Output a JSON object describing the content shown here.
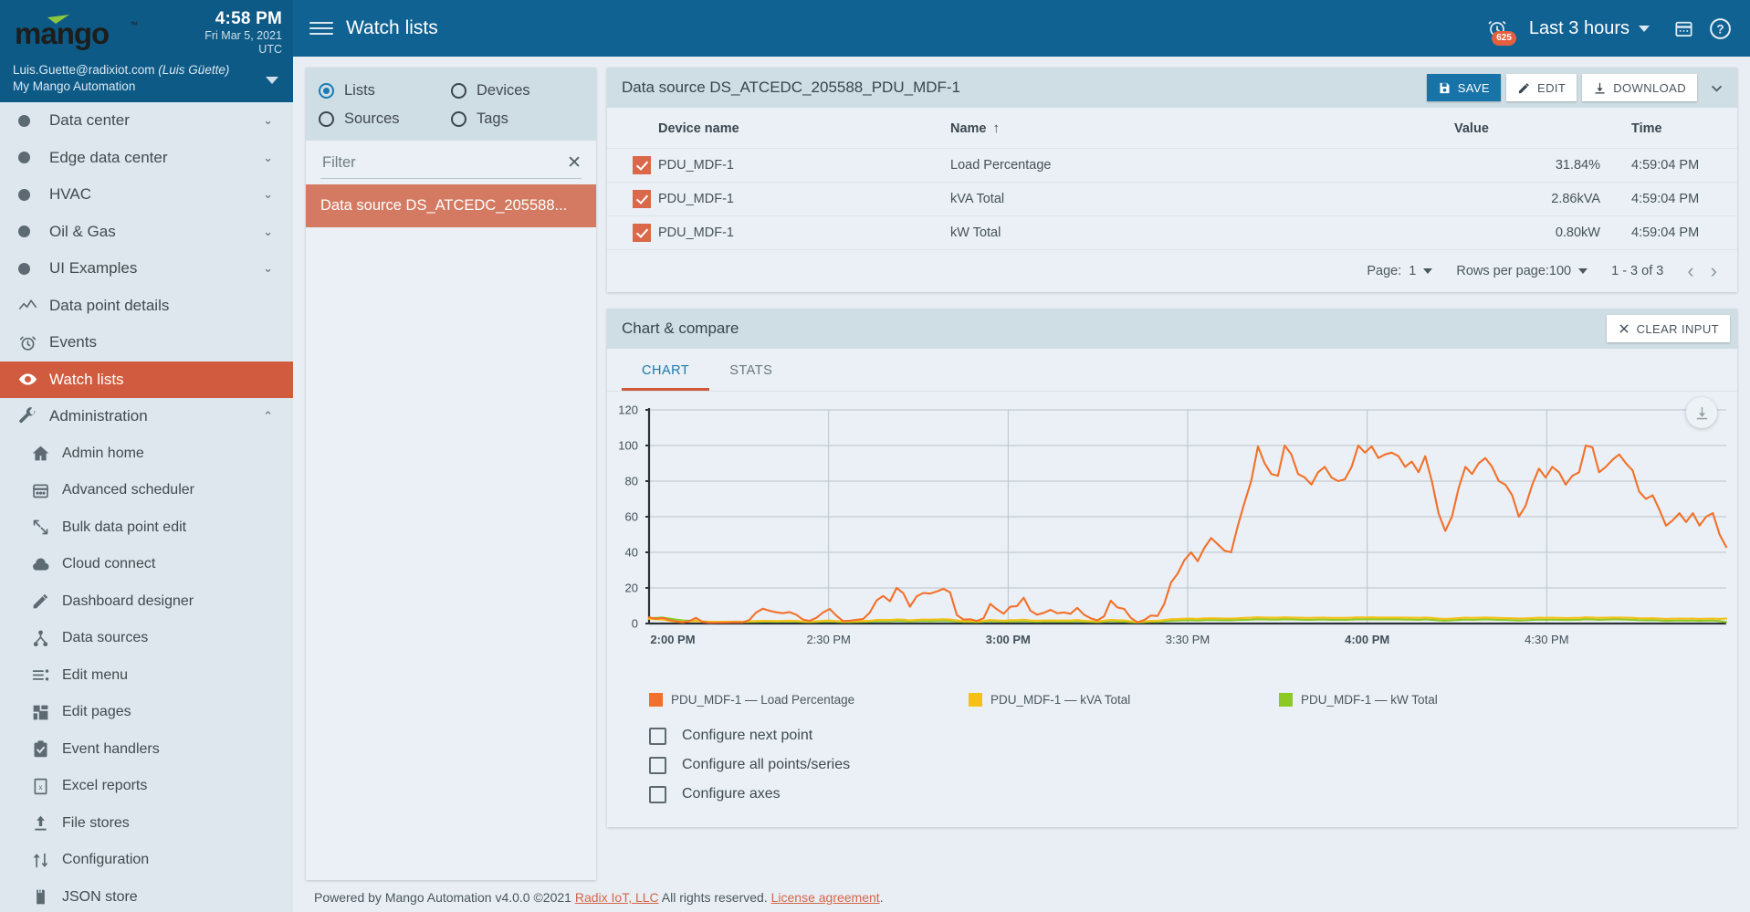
{
  "topbar": {
    "time": "4:58 PM",
    "date": "Fri Mar 5, 2021",
    "timezone": "UTC",
    "page_title": "Watch lists",
    "alarm_count": "625",
    "time_range": "Last 3 hours"
  },
  "user": {
    "email": "Luis.Guette@radixiot.com",
    "display_name": "(Luis Güette)",
    "instance": "My Mango Automation"
  },
  "sidebar": {
    "items": [
      {
        "label": "Data center",
        "icon": "dot-icon",
        "expandable": true,
        "sub": false,
        "active": false
      },
      {
        "label": "Edge data center",
        "icon": "dot-icon",
        "expandable": true,
        "sub": false,
        "active": false
      },
      {
        "label": "HVAC",
        "icon": "dot-icon",
        "expandable": true,
        "sub": false,
        "active": false
      },
      {
        "label": "Oil & Gas",
        "icon": "dot-icon",
        "expandable": true,
        "sub": false,
        "active": false
      },
      {
        "label": "UI Examples",
        "icon": "dot-icon",
        "expandable": true,
        "sub": false,
        "active": false
      },
      {
        "label": "Data point details",
        "icon": "line-chart-icon",
        "expandable": false,
        "sub": false,
        "active": false
      },
      {
        "label": "Events",
        "icon": "alarm-clock-icon",
        "expandable": false,
        "sub": false,
        "active": false
      },
      {
        "label": "Watch lists",
        "icon": "eye-icon",
        "expandable": false,
        "sub": false,
        "active": true
      },
      {
        "label": "Administration",
        "icon": "wrench-icon",
        "expandable": true,
        "sub": false,
        "active": false,
        "expanded": true
      },
      {
        "label": "Admin home",
        "icon": "home-icon",
        "expandable": false,
        "sub": true,
        "active": false
      },
      {
        "label": "Advanced scheduler",
        "icon": "calendar-icon",
        "expandable": false,
        "sub": true,
        "active": false
      },
      {
        "label": "Bulk data point edit",
        "icon": "bulk-edit-icon",
        "expandable": false,
        "sub": true,
        "active": false
      },
      {
        "label": "Cloud connect",
        "icon": "cloud-icon",
        "expandable": false,
        "sub": true,
        "active": false
      },
      {
        "label": "Dashboard designer",
        "icon": "pencil-icon",
        "expandable": false,
        "sub": true,
        "active": false
      },
      {
        "label": "Data sources",
        "icon": "sitemap-icon",
        "expandable": false,
        "sub": true,
        "active": false
      },
      {
        "label": "Edit menu",
        "icon": "menu-list-icon",
        "expandable": false,
        "sub": true,
        "active": false
      },
      {
        "label": "Edit pages",
        "icon": "grid-layout-icon",
        "expandable": false,
        "sub": true,
        "active": false
      },
      {
        "label": "Event handlers",
        "icon": "clipboard-check-icon",
        "expandable": false,
        "sub": true,
        "active": false
      },
      {
        "label": "Excel reports",
        "icon": "excel-file-icon",
        "expandable": false,
        "sub": true,
        "active": false
      },
      {
        "label": "File stores",
        "icon": "upload-icon",
        "expandable": false,
        "sub": true,
        "active": false
      },
      {
        "label": "Configuration",
        "icon": "import-export-icon",
        "expandable": false,
        "sub": true,
        "active": false
      },
      {
        "label": "JSON store",
        "icon": "database-icon",
        "expandable": false,
        "sub": true,
        "active": false
      }
    ]
  },
  "watchlist_panel": {
    "radios": [
      {
        "label": "Lists",
        "selected": true
      },
      {
        "label": "Devices",
        "selected": false
      },
      {
        "label": "Sources",
        "selected": false
      },
      {
        "label": "Tags",
        "selected": false
      }
    ],
    "filter_placeholder": "Filter",
    "filter_value": "",
    "selected_list": "Data source DS_ATCEDC_205588..."
  },
  "datasource_card": {
    "title": "Data source DS_ATCEDC_205588_PDU_MDF-1",
    "buttons": {
      "save": "SAVE",
      "edit": "EDIT",
      "download": "DOWNLOAD"
    },
    "columns": [
      "Device name",
      "Name",
      "Value",
      "Time"
    ],
    "sorted_column": "Name",
    "sort_direction": "asc",
    "rows": [
      {
        "checked": true,
        "device": "PDU_MDF-1",
        "name": "Load Percentage",
        "value": "31.84%",
        "time": "4:59:04 PM"
      },
      {
        "checked": true,
        "device": "PDU_MDF-1",
        "name": "kVA Total",
        "value": "2.86kVA",
        "time": "4:59:04 PM"
      },
      {
        "checked": true,
        "device": "PDU_MDF-1",
        "name": "kW Total",
        "value": "0.80kW",
        "time": "4:59:04 PM"
      }
    ],
    "pager": {
      "page_label": "Page:",
      "page_value": "1",
      "rows_per_page_label": "Rows per page:100",
      "range": "1 - 3 of 3"
    }
  },
  "chart_card": {
    "title": "Chart & compare",
    "clear_input_label": "CLEAR INPUT",
    "tabs": [
      {
        "label": "CHART",
        "active": true
      },
      {
        "label": "STATS",
        "active": false
      }
    ],
    "checkboxes": [
      {
        "label": "Configure next point",
        "checked": false
      },
      {
        "label": "Configure all points/series",
        "checked": false
      },
      {
        "label": "Configure axes",
        "checked": false
      }
    ]
  },
  "footer": {
    "text_before": "Powered by Mango Automation v4.0.0 ©2021 ",
    "link1": "Radix IoT, LLC",
    "text_mid": " All rights reserved. ",
    "link2": "License agreement",
    "text_after": "."
  },
  "colors": {
    "brand_blue": "#106293",
    "accent_orange": "#d15b3f",
    "series_load_percentage": "#f4702a",
    "series_kva_total": "#f5c119",
    "series_kw_total": "#8cc925",
    "panel_header": "#cfdee4",
    "panel_body": "#eaf0f5"
  },
  "chart_data": {
    "type": "line",
    "title": "",
    "xlabel": "",
    "ylabel": "",
    "ylim": [
      0,
      120
    ],
    "yticks": [
      0,
      20,
      40,
      60,
      80,
      100,
      120
    ],
    "grid": true,
    "legend_position": "bottom",
    "xtick_labels": [
      "2:00 PM",
      "2:30 PM",
      "3:00 PM",
      "3:30 PM",
      "4:00 PM",
      "4:30 PM"
    ],
    "xtick_bold": [
      true,
      false,
      true,
      false,
      true,
      false
    ],
    "x_start": "2:00 PM",
    "x_end": "4:58 PM",
    "series": [
      {
        "name": "PDU_MDF-1 — Load Percentage",
        "color": "#f4702a",
        "values": [
          3.5,
          2.6,
          3.2,
          2.0,
          1.2,
          0.6,
          1.4,
          3.2,
          1.0,
          0.4,
          0.5,
          0.5,
          0.6,
          0.7,
          0.6,
          2.0,
          6.2,
          8.3,
          7.2,
          6.3,
          5.8,
          6.4,
          5.0,
          2.2,
          1.5,
          3.2,
          6.2,
          8.2,
          4.4,
          1.4,
          1.6,
          2.1,
          2.5,
          6.2,
          13.0,
          15.5,
          12.5,
          20.0,
          17.0,
          9.5,
          15.3,
          17.2,
          16.8,
          18.0,
          19.5,
          17.5,
          4.8,
          2.2,
          2.4,
          1.5,
          3.0,
          11.0,
          8.0,
          5.5,
          9.5,
          9.8,
          14.5,
          7.2,
          5.0,
          6.0,
          7.7,
          5.8,
          6.2,
          5.5,
          8.8,
          5.0,
          3.0,
          1.8,
          4.0,
          12.8,
          9.0,
          8.2,
          3.2,
          0.6,
          2.0,
          4.5,
          4.2,
          11.0,
          23.0,
          28.0,
          35.5,
          40.0,
          35.0,
          42.5,
          48.0,
          44.5,
          41.0,
          40.0,
          55.0,
          68.0,
          80.0,
          99.5,
          90.0,
          84.0,
          83.0,
          100.0,
          95.0,
          84.0,
          82.0,
          78.0,
          85.0,
          88.0,
          82.0,
          80.0,
          81.0,
          88.0,
          100.0,
          96.0,
          99.5,
          93.0,
          95.0,
          96.0,
          94.0,
          88.0,
          91.0,
          85.0,
          94.0,
          80.0,
          62.0,
          52.0,
          60.0,
          76.0,
          88.0,
          84.0,
          90.0,
          93.0,
          88.0,
          80.0,
          78.0,
          72.0,
          60.0,
          66.0,
          78.0,
          87.0,
          82.0,
          88.0,
          85.0,
          78.0,
          83.0,
          85.0,
          100.0,
          99.0,
          85.0,
          88.0,
          92.0,
          95.0,
          90.0,
          86.0,
          74.0,
          70.0,
          72.0,
          64.0,
          55.0,
          58.0,
          62.0,
          57.0,
          62.0,
          55.0,
          60.0,
          62.0,
          50.0,
          43.0
        ],
        "unit": "%"
      },
      {
        "name": "PDU_MDF-1 — kVA Total",
        "color": "#f5c119",
        "values": [
          2.6,
          2.4,
          2.2,
          1.6,
          1.1,
          1.0,
          1.2,
          1.4,
          1.0,
          0.9,
          0.9,
          1.0,
          1.0,
          1.1,
          1.0,
          1.2,
          1.4,
          1.5,
          1.5,
          1.4,
          1.5,
          1.6,
          1.5,
          1.2,
          1.1,
          1.3,
          1.6,
          1.7,
          1.4,
          1.1,
          1.2,
          1.3,
          1.4,
          1.6,
          2.0,
          2.1,
          2.0,
          2.3,
          2.2,
          1.8,
          2.1,
          2.3,
          2.2,
          2.3,
          2.4,
          2.3,
          1.8,
          1.4,
          1.4,
          1.2,
          1.5,
          2.0,
          1.8,
          1.6,
          1.9,
          1.9,
          2.2,
          1.7,
          1.6,
          1.7,
          1.8,
          1.7,
          1.8,
          1.7,
          2.0,
          1.6,
          1.4,
          1.2,
          1.6,
          2.1,
          1.9,
          1.8,
          1.3,
          0.9,
          1.2,
          1.5,
          1.5,
          2.0,
          2.4,
          2.5,
          2.7,
          2.8,
          2.6,
          2.9,
          3.0,
          2.9,
          2.8,
          2.8,
          3.0,
          3.2,
          3.3,
          3.5,
          3.4,
          3.3,
          3.3,
          3.5,
          3.4,
          3.3,
          3.2,
          3.2,
          3.3,
          3.3,
          3.2,
          3.2,
          3.2,
          3.3,
          3.5,
          3.4,
          3.5,
          3.4,
          3.4,
          3.4,
          3.4,
          3.3,
          3.3,
          3.2,
          3.4,
          3.2,
          2.8,
          2.6,
          2.8,
          3.1,
          3.3,
          3.2,
          3.3,
          3.4,
          3.3,
          3.2,
          3.1,
          3.0,
          2.8,
          2.9,
          3.1,
          3.3,
          3.2,
          3.3,
          3.2,
          3.1,
          3.2,
          3.2,
          3.5,
          3.4,
          3.2,
          3.3,
          3.4,
          3.4,
          3.3,
          3.2,
          3.0,
          2.9,
          3.0,
          2.8,
          2.6,
          2.7,
          2.8,
          2.7,
          2.8,
          2.6,
          2.7,
          2.8,
          2.6,
          2.86
        ],
        "unit": "kVA"
      },
      {
        "name": "PDU_MDF-1 — kW Total",
        "color": "#8cc925",
        "values": [
          3.0,
          3.2,
          3.4,
          2.8,
          2.2,
          1.8,
          1.6,
          1.6,
          1.2,
          0.9,
          0.8,
          0.8,
          0.8,
          0.9,
          0.8,
          0.9,
          1.0,
          1.1,
          1.1,
          1.0,
          1.1,
          1.2,
          1.1,
          0.9,
          0.8,
          0.9,
          1.1,
          1.2,
          1.0,
          0.8,
          0.8,
          0.9,
          1.0,
          1.1,
          1.3,
          1.4,
          1.3,
          1.5,
          1.4,
          1.2,
          1.4,
          1.5,
          1.4,
          1.5,
          1.6,
          1.5,
          1.2,
          0.9,
          0.9,
          0.8,
          1.0,
          1.3,
          1.2,
          1.0,
          1.2,
          1.2,
          1.4,
          1.1,
          1.0,
          1.1,
          1.2,
          1.1,
          1.2,
          1.1,
          1.3,
          1.0,
          0.9,
          0.8,
          1.0,
          1.4,
          1.2,
          1.1,
          0.8,
          0.5,
          0.8,
          1.0,
          1.0,
          1.3,
          1.6,
          1.7,
          1.8,
          1.9,
          1.7,
          1.9,
          2.0,
          1.9,
          1.8,
          1.8,
          2.0,
          2.1,
          2.2,
          2.4,
          2.3,
          2.2,
          2.2,
          2.4,
          2.3,
          2.2,
          2.1,
          2.1,
          2.2,
          2.2,
          2.1,
          2.1,
          2.1,
          2.2,
          2.4,
          2.3,
          2.4,
          2.3,
          2.3,
          2.3,
          2.3,
          2.2,
          2.2,
          2.1,
          2.3,
          2.1,
          1.8,
          1.6,
          1.8,
          2.0,
          2.2,
          2.1,
          2.2,
          2.3,
          2.2,
          2.1,
          2.0,
          1.9,
          1.7,
          1.8,
          2.0,
          2.2,
          2.1,
          2.2,
          2.1,
          2.0,
          2.1,
          2.1,
          2.4,
          2.3,
          2.1,
          2.2,
          2.3,
          2.3,
          2.2,
          2.1,
          1.9,
          1.8,
          1.9,
          1.7,
          1.5,
          1.6,
          1.7,
          1.6,
          1.7,
          1.5,
          1.6,
          1.7,
          1.4,
          0.8
        ],
        "unit": "kW"
      }
    ]
  }
}
